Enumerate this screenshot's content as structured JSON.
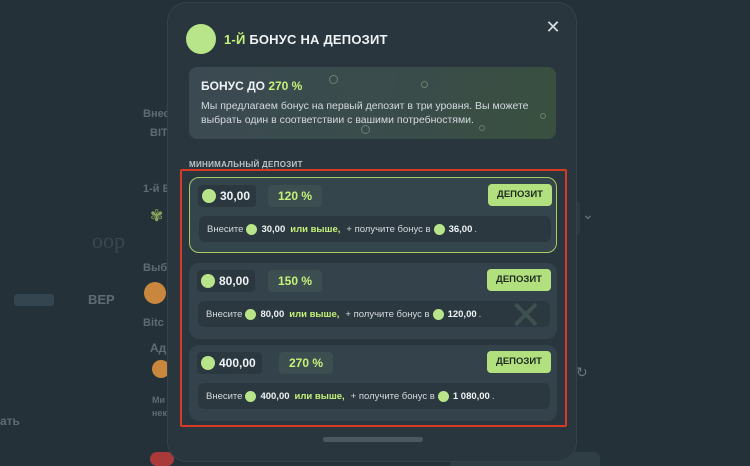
{
  "background": {
    "fragments": [
      "Внес",
      "BIT",
      "1-й Б",
      "Выб",
      "ВЕР",
      "Bitc",
      "Ад",
      "Ми",
      "нек",
      "ать"
    ],
    "big_text": "оор"
  },
  "modal": {
    "title_accent": "1-Й",
    "title_rest": "БОНУС НА ДЕПОЗИТ",
    "close_icon": "close-icon",
    "bonus_card": {
      "title_prefix": "БОНУС ДО",
      "title_value": "270 %",
      "description": "Мы предлагаем бонус на первый депозит в три уровня. Вы можете выбрать один в соответствии с вашими потребностями."
    },
    "section_label": "МИНИМАЛЬНЫЙ ДЕПОЗИТ",
    "tiers": [
      {
        "amount": "30,00",
        "percent": "120 %",
        "button": "ДЕПОЗИТ",
        "info_prefix": "Внесите",
        "info_amount": "30,00",
        "info_or_more": "или выше,",
        "info_middle": "+ получите бонус в",
        "info_bonus": "36,00",
        "info_end": "."
      },
      {
        "amount": "80,00",
        "percent": "150 %",
        "button": "ДЕПОЗИТ",
        "info_prefix": "Внесите",
        "info_amount": "80,00",
        "info_or_more": "или выше,",
        "info_middle": "+ получите бонус в",
        "info_bonus": "120,00",
        "info_end": "."
      },
      {
        "amount": "400,00",
        "percent": "270 %",
        "button": "ДЕПОЗИТ",
        "info_prefix": "Внесите",
        "info_amount": "400,00",
        "info_or_more": "или выше,",
        "info_middle": "+ получите бонус в",
        "info_bonus": "1 080,00",
        "info_end": "."
      }
    ]
  },
  "colors": {
    "accent": "#c6f27a",
    "button": "#b3e07e",
    "highlight_frame": "#d63a26",
    "modal_bg": "#2a363d"
  }
}
